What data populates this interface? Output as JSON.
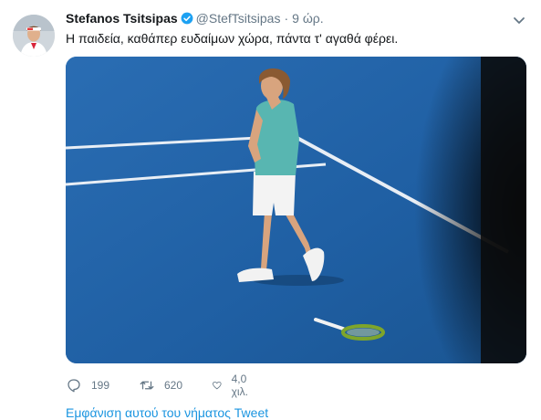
{
  "tweet": {
    "author_name": "Stefanos Tsitsipas",
    "author_handle": "@StefTsitsipas",
    "separator": "·",
    "timestamp": "9 ώρ.",
    "text": "Η παιδεία, καθάπερ ευδαίμων χώρα, πάντα τ' αγαθά φέρει."
  },
  "actions": {
    "reply_count": "199",
    "retweet_count": "620",
    "like_count": "4,0 χιλ."
  },
  "thread_link": "Εμφάνιση αυτού του νήματος Tweet",
  "colors": {
    "verified_badge": "#1da1f2",
    "link": "#1b95e0",
    "muted": "#657786",
    "court_blue": "#1e60a5"
  },
  "icons": {
    "verified": "verified-badge-icon",
    "caret": "chevron-down-icon",
    "reply": "reply-icon",
    "retweet": "retweet-icon",
    "like": "heart-icon"
  }
}
